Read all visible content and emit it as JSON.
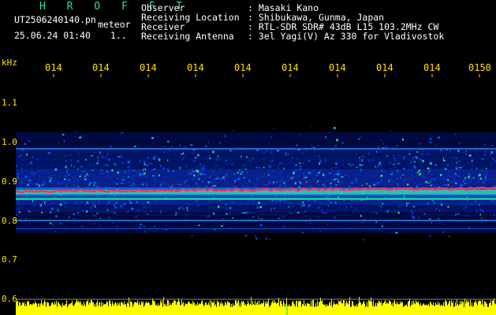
{
  "header": {
    "program": "H R O F F T",
    "filename": "UT2506240140.pn",
    "mode": "meteor",
    "datetime": "25.06.24 01:40",
    "index": "1..",
    "fields": [
      {
        "label": "Observer",
        "value": ": Masaki Kano"
      },
      {
        "label": "Receiving Location",
        "value": ": Shibukawa, Gunma, Japan"
      },
      {
        "label": "Receiver",
        "value": ": RTL-SDR SDR# 43dB L15 103.2MHz CW"
      },
      {
        "label": "Receiving Antenna",
        "value": ": 3el Yagi(V) Az 330 for Vladivostok"
      }
    ]
  },
  "time_axis": {
    "labels": [
      "014",
      "014",
      "014",
      "014",
      "014",
      "014",
      "014",
      "014",
      "014",
      "0150"
    ]
  },
  "freq_axis": {
    "unit": "kHz",
    "labels": [
      "1.1",
      "1.0",
      "0.9",
      "0.8",
      "0.7",
      "0.6"
    ]
  },
  "colors": {
    "background": "#000000",
    "header_text": "#ffffff",
    "title": "#2ee0a8",
    "axis_text": "#ffe000",
    "signal_trace": "#ff3060",
    "level_bars": "#ffff00",
    "noise_band": "#1030b0"
  }
}
